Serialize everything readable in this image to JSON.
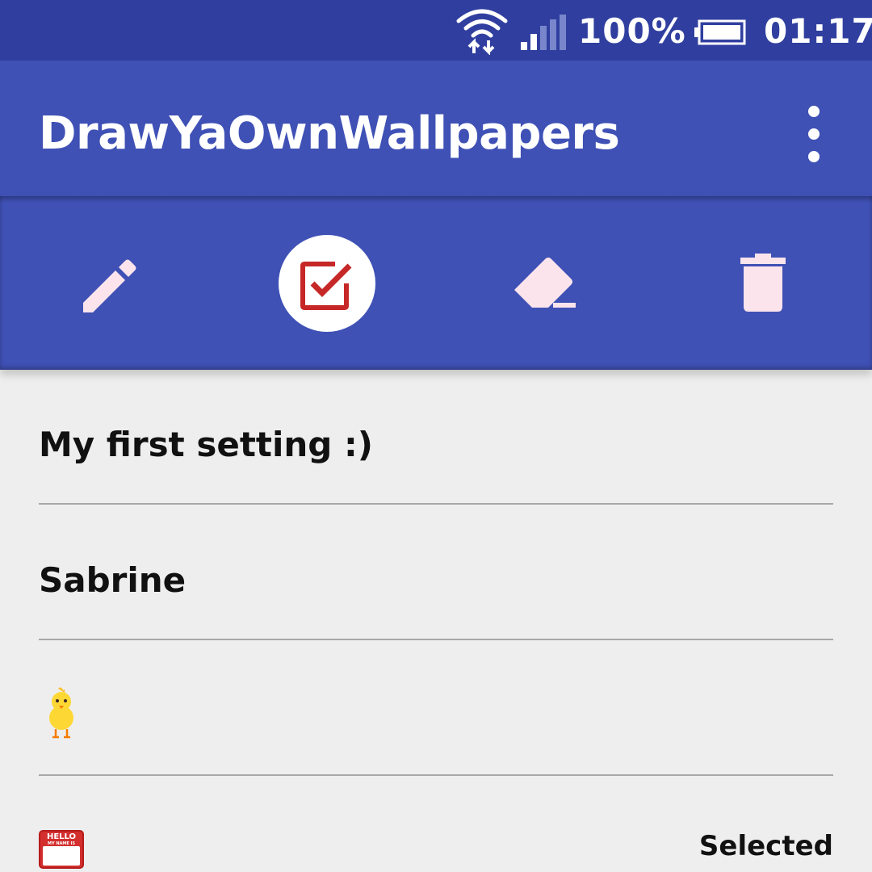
{
  "status_bar": {
    "battery_percent": "100%",
    "time": "01:17",
    "icons": [
      "wifi-data-icon",
      "signal-icon",
      "battery-icon"
    ]
  },
  "app_bar": {
    "title": "DrawYaOwnWallpapers",
    "menu_icon": "overflow-menu-icon"
  },
  "toolbar": {
    "tools": [
      {
        "name": "pencil-icon",
        "active": false
      },
      {
        "name": "checkbox-select-icon",
        "active": true
      },
      {
        "name": "eraser-icon",
        "active": false
      },
      {
        "name": "trash-icon",
        "active": false
      }
    ],
    "icon_color": "#fce4ec",
    "active_icon_color": "#c62828"
  },
  "list": {
    "items": [
      {
        "label": "My first setting :)"
      },
      {
        "label": "Sabrine"
      },
      {
        "label": "",
        "icon": "chick-emoji-icon"
      }
    ],
    "partial_item": {
      "icon": "hello-name-tag-icon",
      "icon_text_top": "HELLO",
      "icon_text_bottom": "MY NAME IS",
      "status": "Selected"
    }
  },
  "colors": {
    "status_bar": "#303f9f",
    "primary": "#3f51b5",
    "background": "#eeeeee",
    "divider": "#a8a8a8"
  }
}
